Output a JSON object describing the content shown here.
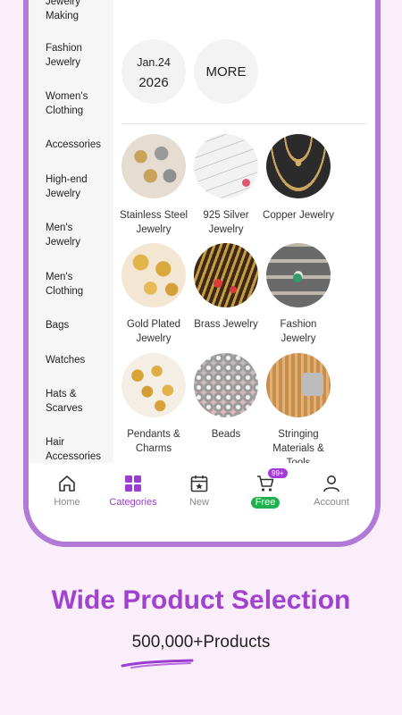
{
  "sidebar": {
    "items": [
      {
        "label": "Jewelry Making"
      },
      {
        "label": "Fashion Jewelry"
      },
      {
        "label": "Women's Clothing"
      },
      {
        "label": "Accessories"
      },
      {
        "label": "High-end Jewelry"
      },
      {
        "label": "Men's Jewelry"
      },
      {
        "label": "Men's Clothing"
      },
      {
        "label": "Bags"
      },
      {
        "label": "Watches"
      },
      {
        "label": "Hats & Scarves"
      },
      {
        "label": "Hair Accessories"
      }
    ]
  },
  "dates": {
    "top_row": [
      "2026",
      "2026",
      "2026"
    ],
    "jan": {
      "line1": "Jan.24",
      "line2": "2026"
    },
    "more": "MORE"
  },
  "categories": [
    {
      "label": "Stainless Steel Jewelry"
    },
    {
      "label": "925 Silver Jewelry"
    },
    {
      "label": "Copper Jewelry"
    },
    {
      "label": "Gold Plated Jewelry"
    },
    {
      "label": "Brass Jewelry"
    },
    {
      "label": "Fashion Jewelry"
    },
    {
      "label": "Pendants & Charms"
    },
    {
      "label": "Beads"
    },
    {
      "label": "Stringing Materials & Tools"
    }
  ],
  "tabbar": {
    "home": "Home",
    "categories": "Categories",
    "new": "New",
    "cart_badge": "99+",
    "free": "Free",
    "account": "Account"
  },
  "promo": {
    "headline": "Wide Product Selection",
    "subline": "500,000+Products"
  },
  "colors": {
    "accent": "#a142cf",
    "frame": "#b17ad6",
    "free_green": "#1fb14f"
  }
}
